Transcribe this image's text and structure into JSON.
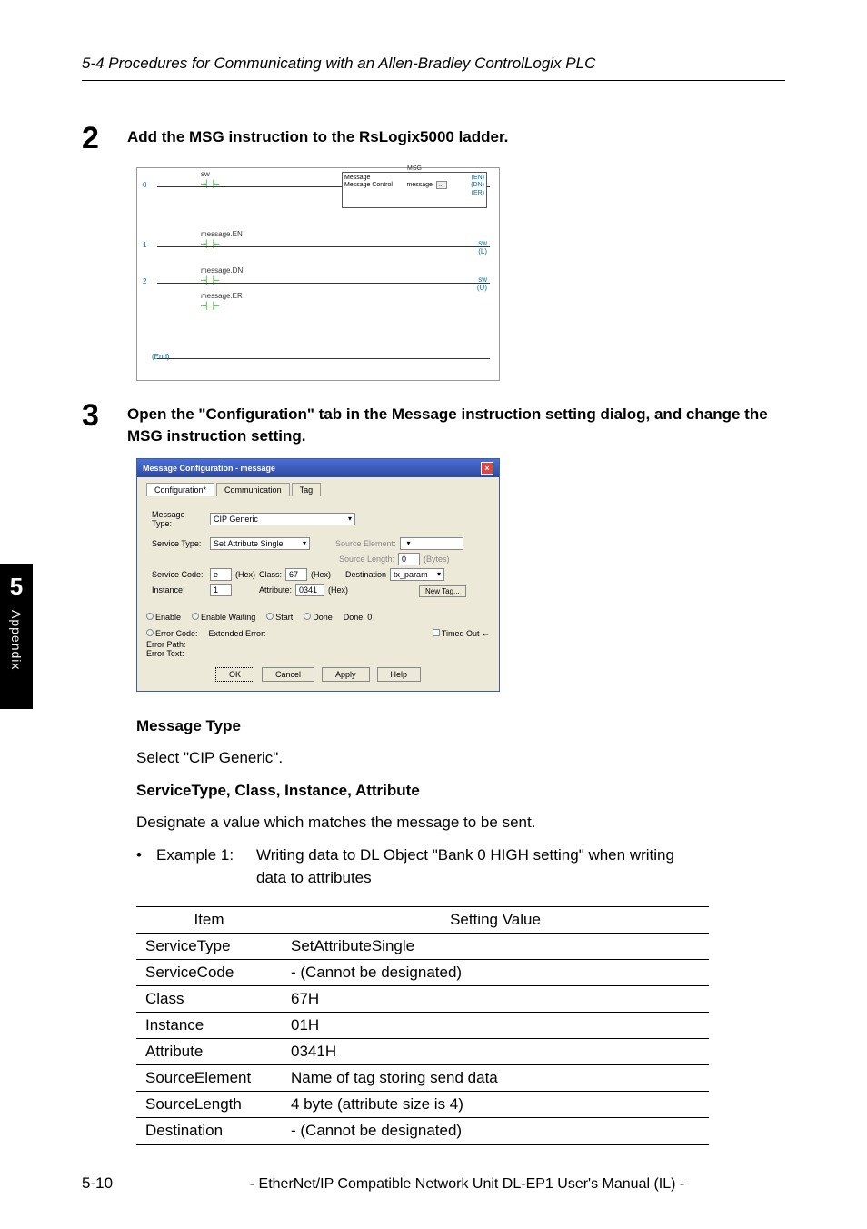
{
  "header": {
    "section": "5-4 Procedures for Communicating with an Allen-Bradley ControlLogix PLC"
  },
  "sideTab": {
    "chapter": "5",
    "label": "Appendix"
  },
  "step2": {
    "num": "2",
    "text": "Add the MSG instruction to the RsLogix5000 ladder.",
    "ladder": {
      "rung0": "0",
      "r0tag": "sw",
      "msgTitle": "MSG",
      "msgL1": "Message",
      "msgL2": "Message Control",
      "msgTag": "message",
      "msgBtn": "...",
      "en": "(EN)",
      "dn": "(DN)",
      "er": "(ER)",
      "rung1": "1",
      "r1tag": "message.EN",
      "r1coilTag": "sw",
      "r1coil": "(L)",
      "rung2": "2",
      "r2tag": "message.DN",
      "r2coilTag": "sw",
      "r2coil": "(U)",
      "r2tag2": "message.ER",
      "end": "(End)"
    }
  },
  "step3": {
    "num": "3",
    "text": "Open the \"Configuration\" tab in the Message instruction setting dialog, and change the MSG instruction setting.",
    "dialog": {
      "title": "Message Configuration - message",
      "tabs": {
        "t1": "Configuration*",
        "t2": "Communication",
        "t3": "Tag"
      },
      "msgTypeLabel": "Message Type:",
      "msgTypeValue": "CIP Generic",
      "svcTypeLabel": "Service Type:",
      "svcTypeValue": "Set Attribute Single",
      "srcElemLabel": "Source Element:",
      "srcLenLabel": "Source Length:",
      "srcLenVal": "0",
      "bytes": "(Bytes)",
      "svcCodeLabel": "Service Code:",
      "svcCodeVal": "e",
      "hex": "(Hex)",
      "classLabel": "Class:",
      "classVal": "67",
      "destLabel": "Destination",
      "destVal": "tx_param",
      "instLabel": "Instance:",
      "instVal": "1",
      "attrLabel": "Attribute:",
      "attrVal": "0341",
      "newTag": "New Tag...",
      "status": {
        "enable": "Enable",
        "enableWaiting": "Enable Waiting",
        "start": "Start",
        "done": "Done",
        "doneVal": "0",
        "errCode": "Error Code:",
        "extErr": "Extended Error:",
        "timedOut": "Timed Out",
        "errPath": "Error Path:",
        "errText": "Error Text:"
      },
      "btns": {
        "ok": "OK",
        "cancel": "Cancel",
        "apply": "Apply",
        "help": "Help"
      }
    }
  },
  "content": {
    "msgTypeH": "Message Type",
    "msgTypeT": "Select \"CIP Generic\".",
    "svcH": "ServiceType, Class, Instance, Attribute",
    "svcT": "Designate a value which matches the message to be sent.",
    "exLabel": "Example 1:",
    "exText": "Writing data to DL Object \"Bank 0 HIGH setting\" when writing",
    "exText2": "data to attributes"
  },
  "table": {
    "h1": "Item",
    "h2": "Setting Value",
    "rows": [
      {
        "item": "ServiceType",
        "val": "SetAttributeSingle"
      },
      {
        "item": "ServiceCode",
        "val": "- (Cannot be designated)"
      },
      {
        "item": "Class",
        "val": "67H"
      },
      {
        "item": "Instance",
        "val": "01H"
      },
      {
        "item": "Attribute",
        "val": "0341H"
      },
      {
        "item": "SourceElement",
        "val": "Name of tag storing send data"
      },
      {
        "item": "SourceLength",
        "val": "4 byte (attribute size is 4)"
      },
      {
        "item": "Destination",
        "val": "- (Cannot be designated)"
      }
    ]
  },
  "footer": {
    "page": "5-10",
    "title": "- EtherNet/IP Compatible Network Unit DL-EP1 User's Manual (IL) -"
  }
}
